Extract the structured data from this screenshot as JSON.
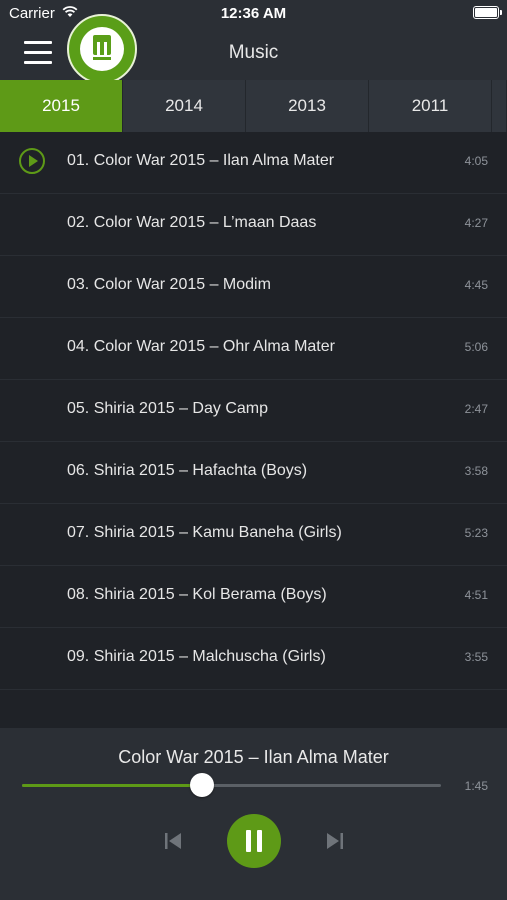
{
  "status": {
    "carrier": "Carrier",
    "time": "12:36 AM"
  },
  "header": {
    "title": "Music",
    "menu_icon": "hamburger-icon"
  },
  "tabs": [
    {
      "label": "2015",
      "active": true
    },
    {
      "label": "2014",
      "active": false
    },
    {
      "label": "2013",
      "active": false
    },
    {
      "label": "2011",
      "active": false
    }
  ],
  "tracks": [
    {
      "title": "01. Color War 2015 – Ilan Alma Mater",
      "duration": "4:05",
      "playing": true
    },
    {
      "title": "02. Color War 2015 – L’maan Daas",
      "duration": "4:27"
    },
    {
      "title": "03. Color War 2015 – Modim",
      "duration": "4:45"
    },
    {
      "title": "04. Color War 2015 – Ohr Alma Mater",
      "duration": "5:06"
    },
    {
      "title": "05. Shiria 2015 – Day Camp",
      "duration": "2:47"
    },
    {
      "title": "06. Shiria 2015 – Hafachta (Boys)",
      "duration": "3:58"
    },
    {
      "title": "07. Shiria 2015 – Kamu Baneha (Girls)",
      "duration": "5:23"
    },
    {
      "title": "08. Shiria 2015 – Kol Berama (Boys)",
      "duration": "4:51"
    },
    {
      "title": "09. Shiria 2015 – Malchuscha (Girls)",
      "duration": "3:55"
    }
  ],
  "player": {
    "now_playing": "Color War 2015 – Ilan Alma Mater",
    "elapsed": "1:45",
    "progress": 0.43,
    "state": "playing"
  },
  "colors": {
    "accent": "#5e9a17",
    "background": "#1f2227",
    "bar": "#2b2f35"
  }
}
